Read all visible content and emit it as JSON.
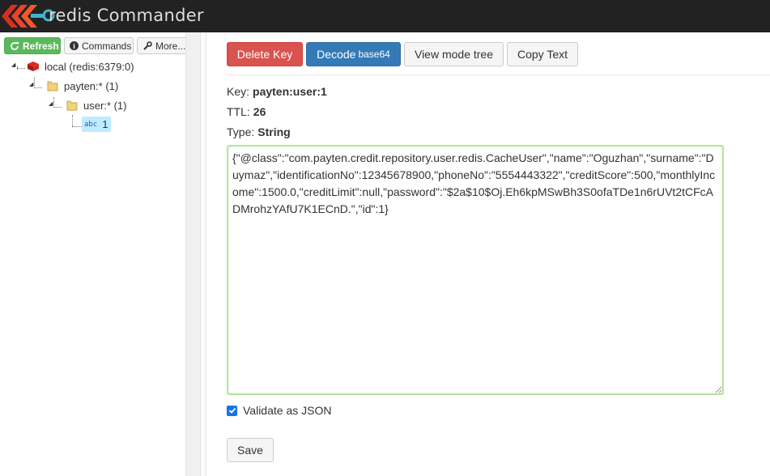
{
  "app": {
    "title": "redis Commander"
  },
  "sidebar": {
    "refresh_label": "Refresh",
    "commands_label": "Commands",
    "more_label": "More...",
    "tree": {
      "server": "local (redis:6379:0)",
      "folder1": "payten:* (1)",
      "folder2": "user:* (1)",
      "leaf_type": "abc",
      "leaf": "1"
    }
  },
  "toolbar": {
    "delete_label": "Delete Key",
    "decode_label": "Decode",
    "decode_small": "base64",
    "viewmode_label": "View mode tree",
    "copy_label": "Copy Text"
  },
  "details": {
    "key_label": "Key:",
    "key_value": "payten:user:1",
    "ttl_label": "TTL:",
    "ttl_value": "26",
    "type_label": "Type:",
    "type_value": "String"
  },
  "editor": {
    "lines": [
      "{\"@class\":\"com.payten.credit.repository.user.redis.CacheUser\",\"name\":\"Oguzhan\",\"surname\":\"D",
      "uymaz\",\"identificationNo\":12345678900,\"phoneNo\":\"5554443322\",\"creditScore\":500,\"monthlyInc",
      "ome\":1500.0,\"creditLimit\":null,\"password\":\"$2a$10$Oj.Eh6kpMSwBh3S0ofaTDe1n6rUVt2tCFcA",
      "DMrohzYAfU7K1ECnD.\",\"id\":1}"
    ]
  },
  "validate": {
    "label": "Validate as JSON",
    "checked": true
  },
  "save_label": "Save",
  "colors": {
    "topbar": "#222222",
    "danger": "#d9534f",
    "primary": "#337ab7",
    "success": "#5cb85c"
  }
}
